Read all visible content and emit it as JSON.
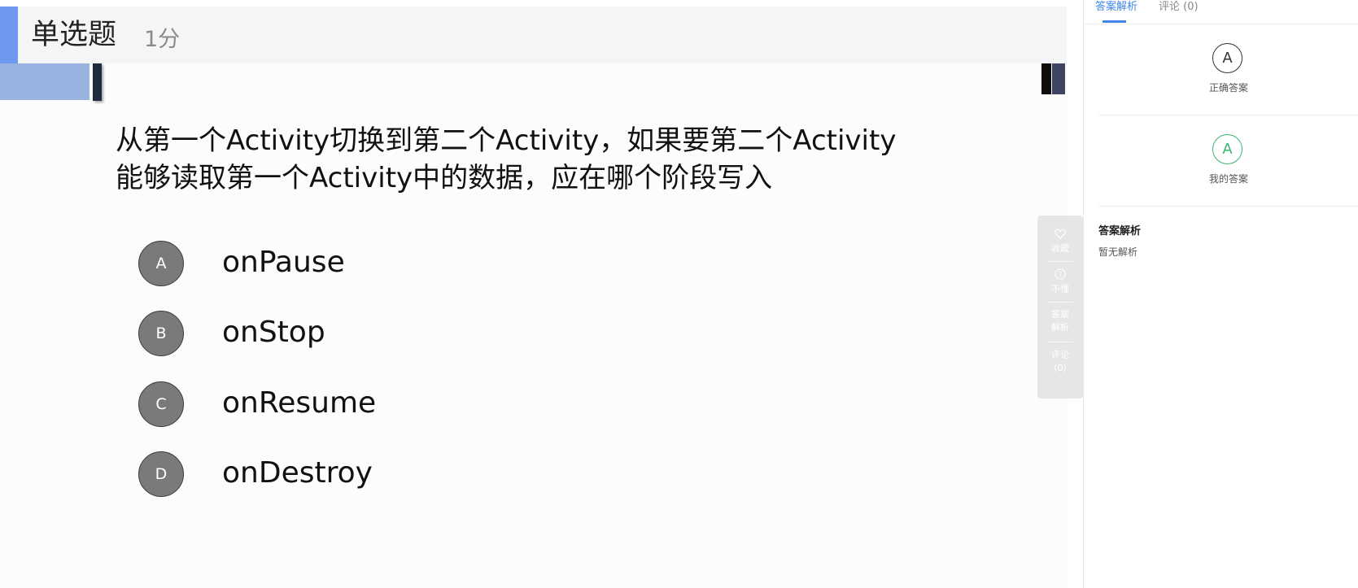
{
  "question": {
    "type_label": "单选题",
    "score_label": "1分",
    "text_line1": "从第一个Activity切换到第二个Activity，如果要第二个Activity",
    "text_line2": "能够读取第一个Activity中的数据，应在哪个阶段写入",
    "options": [
      {
        "letter": "A",
        "text": "onPause"
      },
      {
        "letter": "B",
        "text": "onStop"
      },
      {
        "letter": "C",
        "text": "onResume"
      },
      {
        "letter": "D",
        "text": "onDestroy"
      }
    ]
  },
  "toolbar": {
    "favorite": {
      "icon": "heart-icon",
      "label": "收藏"
    },
    "not_understand": {
      "icon": "question-icon",
      "label": "不懂"
    },
    "analysis": {
      "label_line1": "答案",
      "label_line2": "解析"
    },
    "comment": {
      "label_line1": "评论",
      "label_line2": "(0)"
    }
  },
  "right_panel": {
    "tabs": [
      {
        "label": "答案解析",
        "active": true
      },
      {
        "label": "评论 (0)",
        "active": false
      }
    ],
    "correct_answer": {
      "letter": "A",
      "label": "正确答案"
    },
    "my_answer": {
      "letter": "A",
      "label": "我的答案"
    },
    "analysis_title": "答案解析",
    "analysis_body": "暂无解析"
  },
  "colors": {
    "accent_blue": "#3e87e8",
    "header_accent": "#6f98f0",
    "my_answer_green": "#3cb46e",
    "option_circle": "#7a7a7a"
  }
}
